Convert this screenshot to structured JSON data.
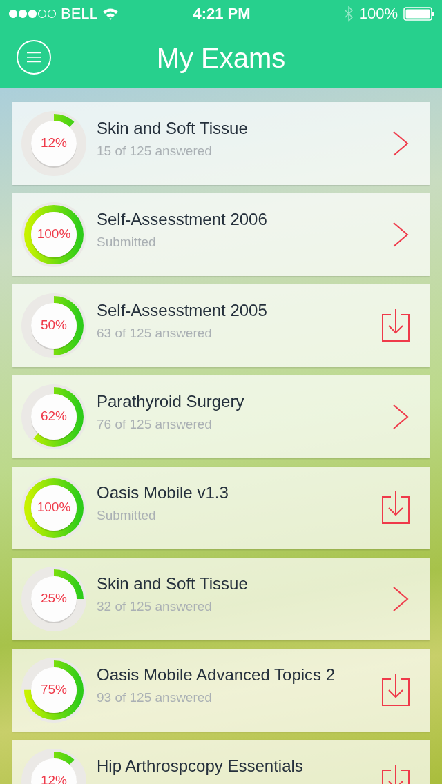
{
  "status_bar": {
    "carrier": "BELL",
    "time": "4:21 PM",
    "battery": "100%"
  },
  "header": {
    "title": "My Exams"
  },
  "exams": [
    {
      "title": "Skin and Soft Tissue",
      "subtitle": "15 of 125 answered",
      "percent": "12%",
      "level": 0.12,
      "kind": "open"
    },
    {
      "title": "Self-Assesstment 2006",
      "subtitle": "Submitted",
      "percent": "100%",
      "level": 1,
      "kind": "open"
    },
    {
      "title": "Self-Assesstment 2005",
      "subtitle": "63 of 125 answered",
      "percent": "50%",
      "level": 0.5,
      "kind": "download"
    },
    {
      "title": "Parathyroid Surgery",
      "subtitle": "76 of 125 answered",
      "percent": "62%",
      "level": 0.62,
      "kind": "open"
    },
    {
      "title": "Oasis Mobile v1.3",
      "subtitle": "Submitted",
      "percent": "100%",
      "level": 1,
      "kind": "download"
    },
    {
      "title": "Skin and Soft Tissue",
      "subtitle": "32 of 125 answered",
      "percent": "25%",
      "level": 0.25,
      "kind": "open"
    },
    {
      "title": "Oasis Mobile Advanced Topics 2",
      "subtitle": "93 of 125 answered",
      "percent": "75%",
      "level": 0.75,
      "kind": "download"
    },
    {
      "title": "Hip Arthrospcopy Essentials",
      "percent": "12%",
      "level": 0.12,
      "kind": "download"
    }
  ]
}
